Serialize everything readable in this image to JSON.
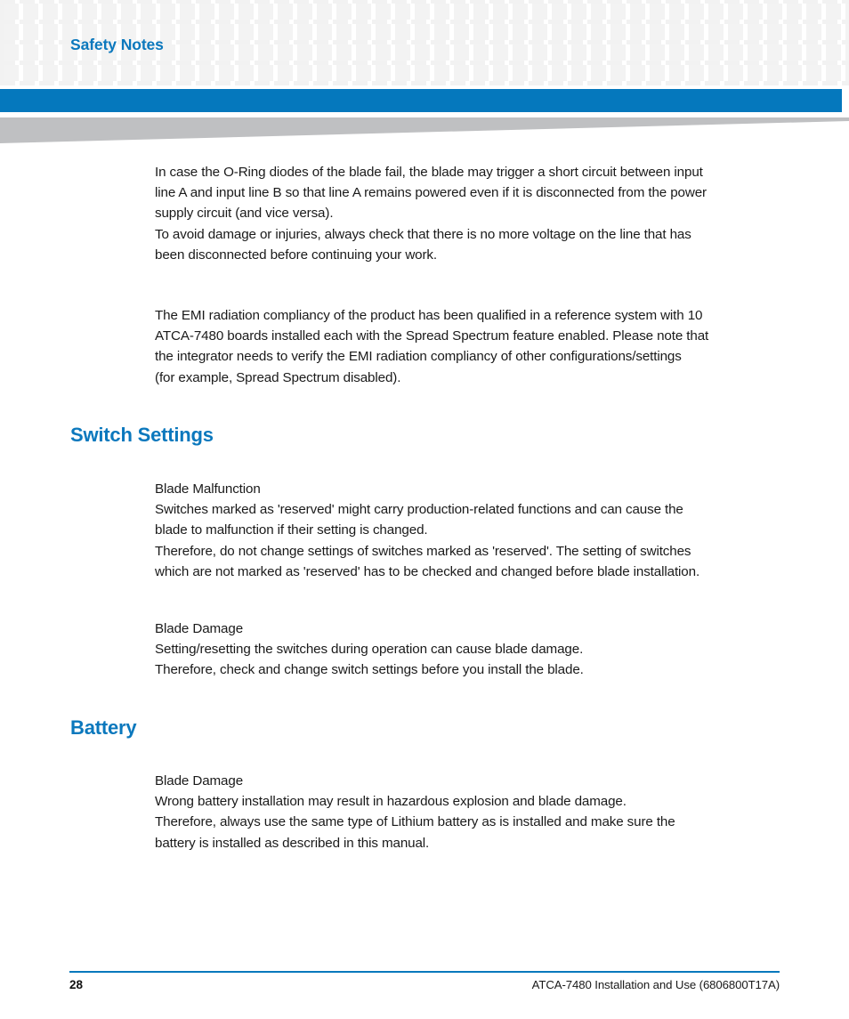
{
  "header": {
    "title": "Safety Notes",
    "accent_color": "#0b78bd",
    "bar_color": "#0578bd",
    "wedge_color": "#bfc0c2",
    "grid_square_color": "#f3f3f3"
  },
  "body": {
    "paragraphs": [
      {
        "id": "oring-warning",
        "lines": [
          "In case the O-Ring diodes of the blade fail, the blade may trigger a short circuit between input",
          "line A and input line B so that line A remains powered even if it is disconnected from the power",
          "supply circuit (and vice versa).",
          "To avoid damage or injuries, always check that there is no more voltage on the line that has",
          "been disconnected before continuing your work."
        ]
      },
      {
        "id": "emi-compliancy",
        "lines": [
          "The EMI radiation compliancy of the product has been qualified in a reference system with 10",
          "ATCA-7480 boards installed each with the Spread Spectrum feature enabled. Please note that",
          "the integrator needs to verify the EMI radiation compliancy of other configurations/settings",
          "(for example, Spread Spectrum disabled)."
        ]
      },
      {
        "id": "blade-malfunction",
        "lines": [
          "Blade Malfunction",
          "Switches marked as 'reserved' might carry production-related functions and can cause the",
          "blade to malfunction if their setting is changed.",
          "Therefore, do not change settings of switches marked as 'reserved'. The setting of switches",
          "which are not marked as 'reserved' has to be checked and changed before blade installation."
        ]
      },
      {
        "id": "blade-damage-switches",
        "lines": [
          "Blade Damage",
          "Setting/resetting the switches during operation can cause blade damage.",
          "Therefore, check and change switch settings before you install the blade."
        ]
      },
      {
        "id": "blade-damage-battery",
        "lines": [
          "Blade Damage",
          "Wrong battery installation may result in hazardous explosion and blade damage.",
          "Therefore, always use the same type of Lithium battery as is installed and make sure the",
          "battery is installed as described in this manual."
        ]
      }
    ],
    "headings": [
      {
        "id": "switch-settings",
        "text": "Switch Settings"
      },
      {
        "id": "battery",
        "text": "Battery"
      }
    ]
  },
  "footer": {
    "page_number": "28",
    "document_title": "ATCA-7480 Installation and Use (6806800T17A)",
    "rule_color": "#0578bd"
  }
}
